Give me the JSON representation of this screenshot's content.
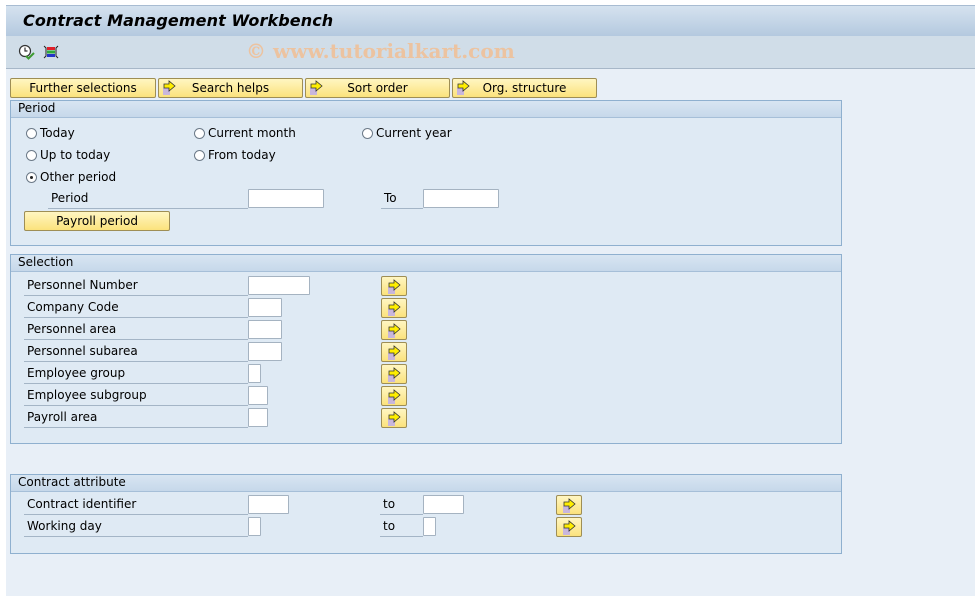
{
  "window": {
    "title": "Contract Management Workbench"
  },
  "toolbar": {
    "icons": [
      "execute-icon",
      "selection-options-icon"
    ],
    "watermark": "© www.tutorialkart.com"
  },
  "tab_buttons": [
    {
      "label": "Further selections",
      "icon": null
    },
    {
      "label": "Search helps",
      "icon": "arrow-right-icon"
    },
    {
      "label": "Sort order",
      "icon": "arrow-right-icon"
    },
    {
      "label": "Org. structure",
      "icon": "arrow-right-icon"
    }
  ],
  "period": {
    "header": "Period",
    "radios": [
      {
        "label": "Today",
        "selected": false
      },
      {
        "label": "Current month",
        "selected": false
      },
      {
        "label": "Current year",
        "selected": false
      },
      {
        "label": "Up to today",
        "selected": false
      },
      {
        "label": "From today",
        "selected": false
      },
      {
        "label": "Other period",
        "selected": true
      }
    ],
    "period_label": "Period",
    "period_from": "",
    "to_label": "To",
    "period_to": "",
    "payroll_button": "Payroll period"
  },
  "selection": {
    "header": "Selection",
    "fields": [
      {
        "label": "Personnel Number",
        "value": ""
      },
      {
        "label": "Company Code",
        "value": ""
      },
      {
        "label": "Personnel area",
        "value": ""
      },
      {
        "label": "Personnel subarea",
        "value": ""
      },
      {
        "label": "Employee group",
        "value": ""
      },
      {
        "label": "Employee subgroup",
        "value": ""
      },
      {
        "label": "Payroll area",
        "value": ""
      }
    ]
  },
  "contract": {
    "header": "Contract attribute",
    "fields": [
      {
        "label": "Contract identifier",
        "from": "",
        "to_label": "to",
        "to": ""
      },
      {
        "label": "Working day",
        "from": "",
        "to_label": "to",
        "to": ""
      }
    ]
  }
}
